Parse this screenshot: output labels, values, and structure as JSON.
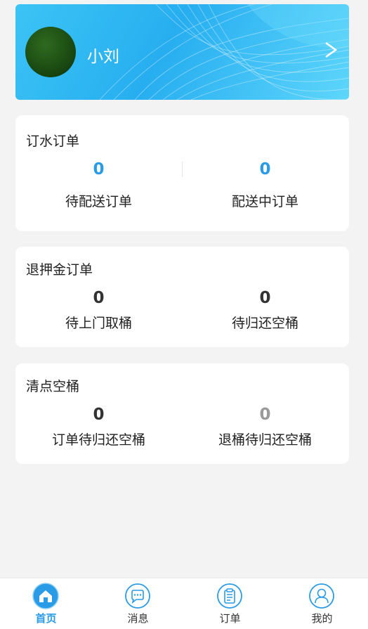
{
  "profile": {
    "name": "小刘"
  },
  "cards": [
    {
      "title": "订水订单",
      "stats": [
        {
          "value": "0",
          "label": "待配送订单"
        },
        {
          "value": "0",
          "label": "配送中订单"
        }
      ]
    },
    {
      "title": "退押金订单",
      "stats": [
        {
          "value": "0",
          "label": "待上门取桶"
        },
        {
          "value": "0",
          "label": "待归还空桶"
        }
      ]
    },
    {
      "title": "清点空桶",
      "stats": [
        {
          "value": "0",
          "label": "订单待归还空桶"
        },
        {
          "value": "0",
          "label": "退桶待归还空桶"
        }
      ]
    }
  ],
  "tabs": [
    {
      "label": "首页",
      "icon": "home-icon",
      "active": true
    },
    {
      "label": "消息",
      "icon": "message-icon"
    },
    {
      "label": "订单",
      "icon": "order-clipboard-icon"
    },
    {
      "label": "我的",
      "icon": "user-icon"
    }
  ],
  "colors": {
    "accent": "#2a9be6",
    "header": "#27aef0",
    "background": "#f3f3f3"
  }
}
